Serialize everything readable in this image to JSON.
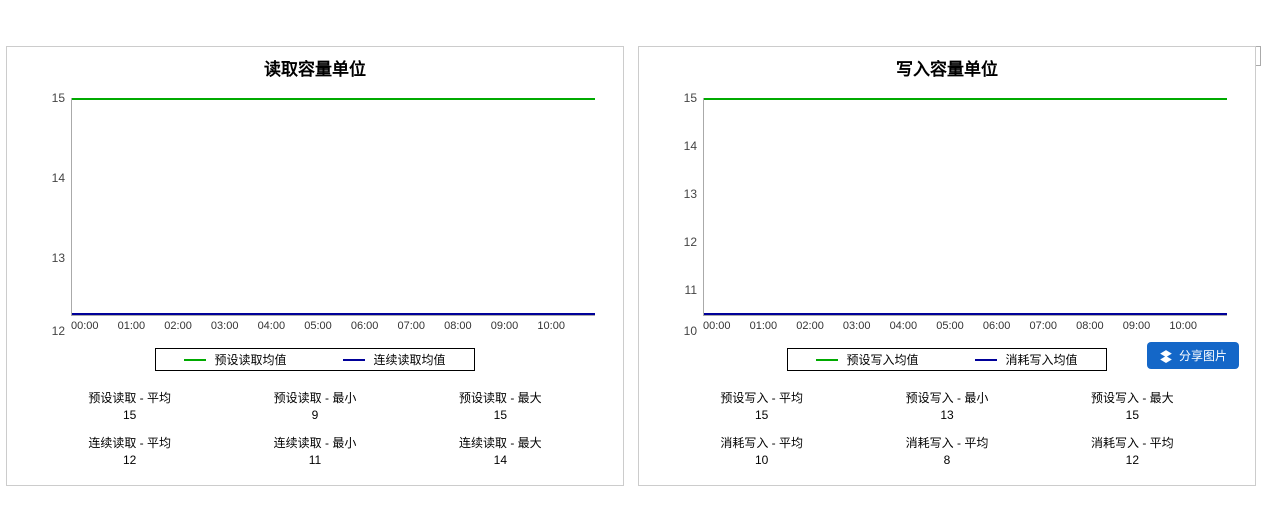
{
  "chart_data": [
    {
      "type": "line",
      "title": "读取容量单位",
      "xlabel": "",
      "ylabel": "",
      "ylim": [
        12,
        15
      ],
      "x": [
        "00:00",
        "01:00",
        "02:00",
        "03:00",
        "04:00",
        "05:00",
        "06:00",
        "07:00",
        "08:00",
        "09:00",
        "10:00"
      ],
      "series": [
        {
          "name": "预设读取均值",
          "color": "#00aa00",
          "values": [
            15,
            15,
            15,
            15,
            15,
            15,
            15,
            15,
            15,
            15,
            15
          ]
        },
        {
          "name": "连续读取均值",
          "color": "#000099",
          "values": [
            12,
            12,
            12,
            12,
            12,
            12,
            12,
            12,
            12,
            12,
            12
          ]
        }
      ],
      "yticks": [
        12,
        13,
        14,
        15
      ],
      "stats": [
        {
          "label": "预设读取 - 平均",
          "value": 15
        },
        {
          "label": "预设读取 - 最小",
          "value": 9
        },
        {
          "label": "预设读取 - 最大",
          "value": 15
        },
        {
          "label": "连续读取 - 平均",
          "value": 12
        },
        {
          "label": "连续读取 - 最小",
          "value": 11
        },
        {
          "label": "连续读取 - 最大",
          "value": 14
        }
      ]
    },
    {
      "type": "line",
      "title": "写入容量单位",
      "xlabel": "",
      "ylabel": "",
      "ylim": [
        10,
        15
      ],
      "x": [
        "00:00",
        "01:00",
        "02:00",
        "03:00",
        "04:00",
        "05:00",
        "06:00",
        "07:00",
        "08:00",
        "09:00",
        "10:00"
      ],
      "series": [
        {
          "name": "预设写入均值",
          "color": "#00aa00",
          "values": [
            15,
            15,
            15,
            15,
            15,
            15,
            15,
            15,
            15,
            15,
            15
          ]
        },
        {
          "name": "消耗写入均值",
          "color": "#000099",
          "values": [
            10,
            10,
            10,
            10,
            10,
            10,
            10,
            10,
            10,
            10,
            10
          ]
        }
      ],
      "yticks": [
        10,
        11,
        12,
        13,
        14,
        15
      ],
      "stats": [
        {
          "label": "预设写入 - 平均",
          "value": 15
        },
        {
          "label": "预设写入 - 最小",
          "value": 13
        },
        {
          "label": "预设写入 - 最大",
          "value": 15
        },
        {
          "label": "消耗写入 - 平均",
          "value": 10
        },
        {
          "label": "消耗写入 - 平均",
          "value": 8
        },
        {
          "label": "消耗写入 - 平均",
          "value": 12
        }
      ]
    }
  ],
  "buttons": {
    "share_label": "分享图片"
  }
}
